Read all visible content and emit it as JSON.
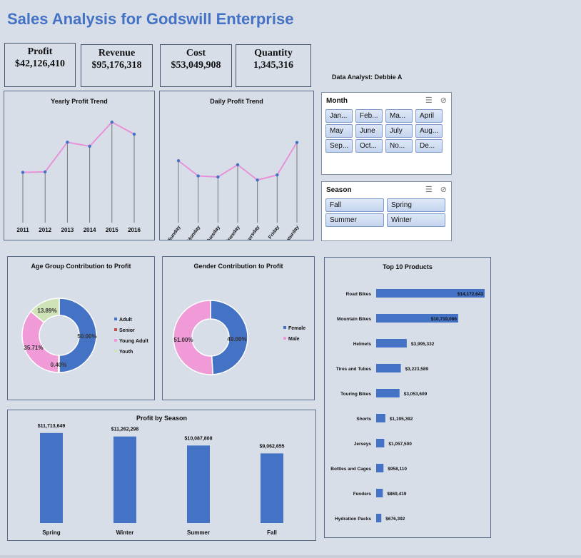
{
  "title": "Sales Analysis for Godswill Enterprise",
  "kpis": [
    {
      "label": "Profit",
      "value": "$42,126,410"
    },
    {
      "label": "Revenue",
      "value": "$95,176,318"
    },
    {
      "label": "Cost",
      "value": "$53,049,908"
    },
    {
      "label": "Quantity",
      "value": "1,345,316"
    }
  ],
  "analyst": "Data Analyst: Debbie A",
  "slicers": {
    "month": {
      "title": "Month",
      "items": [
        "Jan...",
        "Feb...",
        "Ma...",
        "April",
        "May",
        "June",
        "July",
        "Aug...",
        "Sep...",
        "Oct...",
        "No...",
        "De..."
      ]
    },
    "season": {
      "title": "Season",
      "items": [
        "Fall",
        "Spring",
        "Summer",
        "Winter"
      ]
    }
  },
  "colors": {
    "accent": "#4472c4",
    "line": "#e991d8",
    "pink": "#f19ad8",
    "green": "#cfe3b8",
    "title": "#4472c4"
  },
  "chart_data": [
    {
      "id": "yearly",
      "type": "line",
      "title": "Yearly Profit Trend",
      "categories": [
        "2011",
        "2012",
        "2013",
        "2014",
        "2015",
        "2016"
      ],
      "values": [
        5.0,
        5.05,
        8.0,
        7.6,
        10.0,
        8.8
      ],
      "ylim": [
        0,
        12
      ]
    },
    {
      "id": "daily",
      "type": "line",
      "title": "Daily Profit Trend",
      "categories": [
        "Sunday",
        "Monday",
        "Tuesday",
        "Wednesday",
        "Thursday",
        "Friday",
        "Saturday"
      ],
      "values": [
        6.05,
        5.3,
        5.25,
        5.85,
        5.1,
        5.35,
        6.95
      ],
      "ylim": [
        3,
        7.5
      ]
    },
    {
      "id": "age",
      "type": "pie",
      "title": "Age Group Contribution to Profit",
      "labels": [
        "Adult",
        "Senior",
        "Young Adult",
        "Youth"
      ],
      "values": [
        50.0,
        0.4,
        35.71,
        13.89
      ],
      "value_labels": [
        "50.00%",
        "0.40%",
        "35.71%",
        "13.89%"
      ],
      "colors": [
        "#4472c4",
        "#c0504d",
        "#f19ad8",
        "#cfe3b8"
      ],
      "legend": "right"
    },
    {
      "id": "gender",
      "type": "pie",
      "title": "Gender Contribution to Profit",
      "labels": [
        "Female",
        "Male"
      ],
      "values": [
        49.0,
        51.0
      ],
      "value_labels": [
        "49.00%",
        "51.00%"
      ],
      "colors": [
        "#4472c4",
        "#f19ad8"
      ],
      "legend": "right"
    },
    {
      "id": "season",
      "type": "bar",
      "title": "Profit by Season",
      "categories": [
        "Spring",
        "Winter",
        "Summer",
        "Fall"
      ],
      "values": [
        11713649,
        11262298,
        10087808,
        9062655
      ],
      "value_labels": [
        "$11,713,649",
        "$11,262,298",
        "$10,087,808",
        "$9,062,655"
      ],
      "ylim": [
        0,
        13000000
      ]
    },
    {
      "id": "top10",
      "type": "bar",
      "title": "Top 10 Products",
      "categories": [
        "Road Bikes",
        "Mountain Bikes",
        "Helmets",
        "Tires and Tubes",
        "Touring Bikes",
        "Shorts",
        "Jerseys",
        "Bottles and Cages",
        "Fenders",
        "Hydration Packs"
      ],
      "values": [
        14172643,
        10719086,
        3995332,
        3223589,
        3053609,
        1195392,
        1057500,
        958110,
        869419,
        676392
      ],
      "value_labels": [
        "$14,172,643",
        "$10,719,086",
        "$3,995,332",
        "$3,223,589",
        "$3,053,609",
        "$1,195,392",
        "$1,057,500",
        "$958,110",
        "$869,419",
        "$676,392"
      ],
      "xlim": [
        0,
        14172643
      ]
    }
  ]
}
